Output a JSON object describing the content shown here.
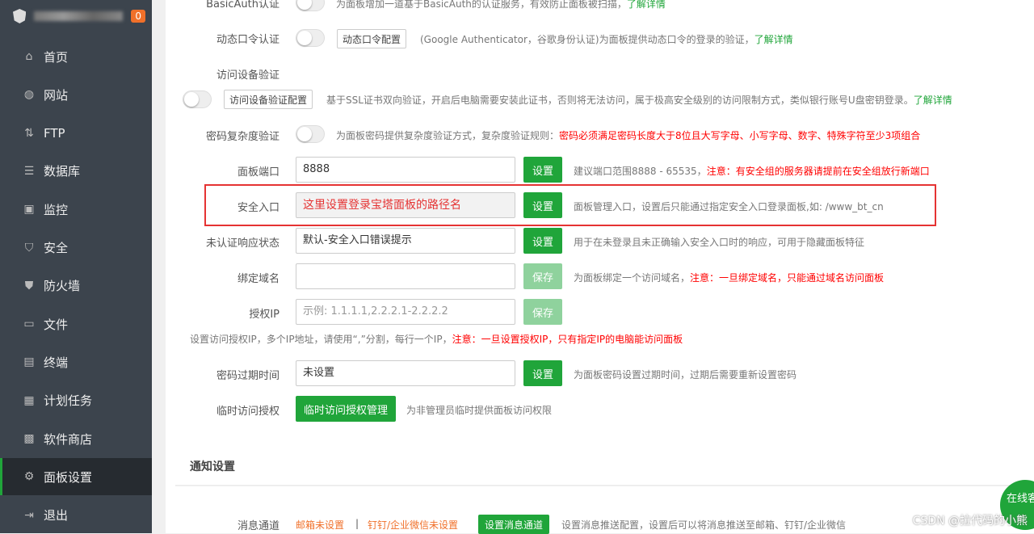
{
  "sidebar": {
    "badge": "0",
    "items": [
      {
        "label": "首页",
        "icon": "home-icon",
        "glyph": "⌂"
      },
      {
        "label": "网站",
        "icon": "globe-icon",
        "glyph": "◍"
      },
      {
        "label": "FTP",
        "icon": "ftp-icon",
        "glyph": "⇅"
      },
      {
        "label": "数据库",
        "icon": "database-icon",
        "glyph": "☰"
      },
      {
        "label": "监控",
        "icon": "monitor-icon",
        "glyph": "▣"
      },
      {
        "label": "安全",
        "icon": "shield-icon",
        "glyph": "⛉"
      },
      {
        "label": "防火墙",
        "icon": "firewall-icon",
        "glyph": "⛊"
      },
      {
        "label": "文件",
        "icon": "folder-icon",
        "glyph": "▭"
      },
      {
        "label": "终端",
        "icon": "terminal-icon",
        "glyph": "▤"
      },
      {
        "label": "计划任务",
        "icon": "calendar-icon",
        "glyph": "▦"
      },
      {
        "label": "软件商店",
        "icon": "apps-icon",
        "glyph": "▩"
      },
      {
        "label": "面板设置",
        "icon": "gear-icon",
        "glyph": "⚙"
      },
      {
        "label": "退出",
        "icon": "logout-icon",
        "glyph": "⇥"
      }
    ]
  },
  "settings": {
    "basicauth": {
      "label": "BasicAuth认证",
      "desc": "为面板增加一道基于BasicAuth的认证服务，有效防止面板被扫描，",
      "link": "了解详情"
    },
    "totp": {
      "label": "动态口令认证",
      "button": "动态口令配置",
      "desc": "(Google Authenticator，谷歌身份认证)为面板提供动态口令的登录的验证，",
      "link": "了解详情"
    },
    "device": {
      "label": "访问设备验证",
      "button": "访问设备验证配置",
      "desc": "基于SSL证书双向验证，开启后电脑需要安装此证书，否则将无法访问，属于极高安全级别的访问限制方式，类似银行账号U盘密钥登录。",
      "link": "了解详情"
    },
    "complexity": {
      "label": "密码复杂度验证",
      "desc": "为面板密码提供复杂度验证方式，复杂度验证规则：",
      "warn": "密码必须满足密码长度大于8位且大写字母、小写字母、数字、特殊字符至少3项组合"
    },
    "port": {
      "label": "面板端口",
      "value": "8888",
      "button": "设置",
      "desc": "建议端口范围8888 - 65535，",
      "warn": "注意：有安全组的服务器请提前在安全组放行新端口"
    },
    "entry": {
      "label": "安全入口",
      "value": "这里设置登录宝塔面板的路径名",
      "button": "设置",
      "desc": "面板管理入口，设置后只能通过指定安全入口登录面板,如: /www_bt_cn"
    },
    "unauth": {
      "label": "未认证响应状态",
      "value": "默认-安全入口错误提示",
      "button": "设置",
      "desc": "用于在未登录且未正确输入安全入口时的响应，可用于隐藏面板特征"
    },
    "domain": {
      "label": "绑定域名",
      "value": "",
      "button": "保存",
      "desc": "为面板绑定一个访问域名，",
      "warn": "注意：一旦绑定域名，只能通过域名访问面板"
    },
    "ip": {
      "label": "授权IP",
      "placeholder": "示例: 1.1.1.1,2.2.2.1-2.2.2.2",
      "button": "保存",
      "note": "设置访问授权IP，多个IP地址，请使用“,”分割，每行一个IP，",
      "warn": "注意：一旦设置授权IP，只有指定IP的电脑能访问面板"
    },
    "expire": {
      "label": "密码过期时间",
      "value": "未设置",
      "button": "设置",
      "desc": "为面板密码设置过期时间，过期后需要重新设置密码"
    },
    "temp": {
      "label": "临时访问授权",
      "button": "临时访问授权管理",
      "desc": "为非管理员临时提供面板访问权限"
    }
  },
  "notify": {
    "title": "通知设置",
    "label": "消息通道",
    "email": "邮箱未设置",
    "sep": "|",
    "dingtalk": "钉钉/企业微信未设置",
    "button": "设置消息通道",
    "desc": "设置消息推送配置，设置后可以将消息推送至邮箱、钉钉/企业微信"
  },
  "float_service": "在线客服",
  "watermark": "CSDN @拉代码的小熊"
}
